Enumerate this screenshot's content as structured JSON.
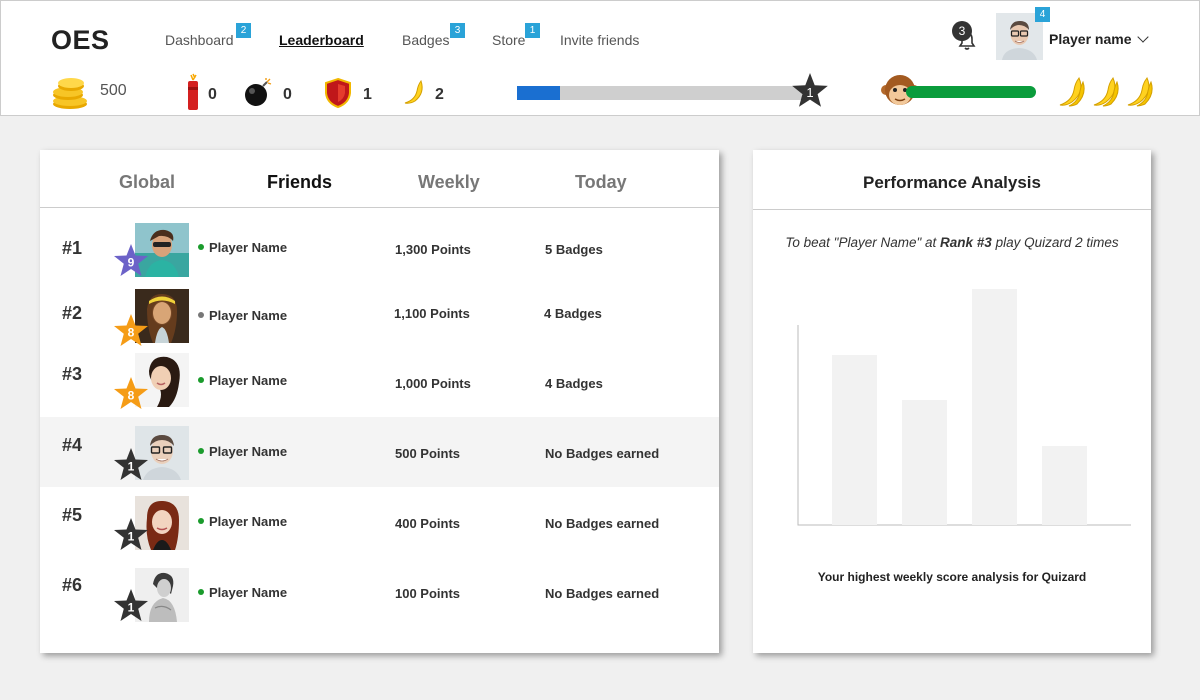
{
  "app": {
    "logo": "OES"
  },
  "nav": [
    {
      "label": "Dashboard",
      "badge": "2"
    },
    {
      "label": "Leaderboard",
      "badge": ""
    },
    {
      "label": "Badges",
      "badge": "3"
    },
    {
      "label": "Store",
      "badge": "1"
    },
    {
      "label": "Invite friends",
      "badge": ""
    }
  ],
  "user": {
    "notifications": "3",
    "avatar_badge": "4",
    "name": "Player name"
  },
  "stats": {
    "coins": "500",
    "dynamite": "0",
    "bomb": "0",
    "shield": "1",
    "banana": "2",
    "level": "1",
    "xp_progress": 0.15,
    "energy_progress": 1.0,
    "lives": 3
  },
  "leaderboard": {
    "tabs": [
      {
        "label": "Global"
      },
      {
        "label": "Friends"
      },
      {
        "label": "Weekly"
      },
      {
        "label": "Today"
      }
    ],
    "active_tab": "Friends",
    "rows": [
      {
        "rank": "#1",
        "level": "9",
        "name": "Player Name",
        "points": "1,300 Points",
        "badges": "5 Badges",
        "star_color": "#6c62c8",
        "online": "#1a9b2c"
      },
      {
        "rank": "#2",
        "level": "8",
        "name": "Player Name",
        "points": "1,100 Points",
        "badges": "4 Badges",
        "star_color": "#f59c16",
        "online": "#777777"
      },
      {
        "rank": "#3",
        "level": "8",
        "name": "Player Name",
        "points": "1,000 Points",
        "badges": "4 Badges",
        "star_color": "#f59c16",
        "online": "#1a9b2c"
      },
      {
        "rank": "#4",
        "level": "1",
        "name": "Player Name",
        "points": "500 Points",
        "badges": "No Badges earned",
        "star_color": "#333333",
        "online": "#1a9b2c"
      },
      {
        "rank": "#5",
        "level": "1",
        "name": "Player Name",
        "points": "400 Points",
        "badges": "No Badges earned",
        "star_color": "#333333",
        "online": "#1a9b2c"
      },
      {
        "rank": "#6",
        "level": "1",
        "name": "Player Name",
        "points": "100 Points",
        "badges": "No Badges earned",
        "star_color": "#333333",
        "online": "#1a9b2c"
      }
    ]
  },
  "performance": {
    "title": "Performance Analysis",
    "tip_prefix": "To beat \"Player Name\" at ",
    "tip_rank": "Rank #3",
    "tip_suffix": " play Quizard 2 times",
    "caption": "Your highest weekly score analysis for Quizard",
    "bar_color": "#f2f2f2",
    "axis_color": "#bbbbbb"
  },
  "chart_data": {
    "type": "bar",
    "categories": [
      "",
      "",
      "",
      ""
    ],
    "values": [
      170,
      125,
      236,
      79
    ],
    "ylim": [
      0,
      240
    ],
    "title": "",
    "xlabel": "",
    "ylabel": "",
    "grid": false
  },
  "colors": {
    "accent": "#2aa3d8",
    "xp": "#1a6fd1",
    "energy": "#0a9c3c",
    "highlight_row": "#f4f4f4"
  }
}
